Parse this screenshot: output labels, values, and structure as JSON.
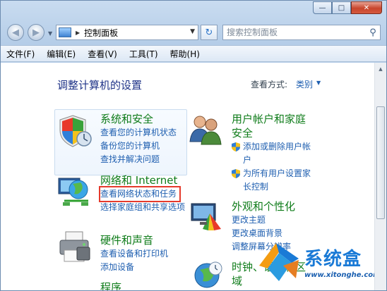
{
  "window": {
    "caption_minimize": "—",
    "caption_maximize": "□",
    "caption_close": "✕"
  },
  "address_bar": {
    "back_glyph": "◀",
    "forward_glyph": "▶",
    "path_label": "控制面板",
    "chevron": "▶",
    "dropdown": "▼",
    "refresh_glyph": "↻"
  },
  "search": {
    "placeholder": "搜索控制面板",
    "icon": "search-icon"
  },
  "menu": [
    "文件(F)",
    "编辑(E)",
    "查看(V)",
    "工具(T)",
    "帮助(H)"
  ],
  "content": {
    "title": "调整计算机的设置",
    "view_label": "查看方式:",
    "view_value": "类别",
    "view_drop": "▼"
  },
  "categories": {
    "system_security": {
      "title": "系统和安全",
      "links": [
        "查看您的计算机状态",
        "备份您的计算机",
        "查找并解决问题"
      ]
    },
    "network": {
      "title": "网络和 Internet",
      "links": [
        "查看网络状态和任务",
        "选择家庭组和共享选项"
      ]
    },
    "hardware": {
      "title": "硬件和声音",
      "links": [
        "查看设备和打印机",
        "添加设备"
      ]
    },
    "program_partial": "程序",
    "user_accounts": {
      "title_line1": "用户帐户和家庭",
      "title_line2": "安全",
      "links": [
        {
          "line1": "添加或删除用户帐",
          "line2": "户"
        },
        {
          "line1": "为所有用户设置家",
          "line2": "长控制"
        }
      ]
    },
    "appearance": {
      "title": "外观和个性化",
      "links": [
        "更改主题",
        "更改桌面背景",
        "调整屏幕分辨率"
      ]
    },
    "clock": {
      "title_line1": "时钟、语言和区",
      "title_line2": "域"
    }
  },
  "watermark": {
    "brand": "系统盒",
    "url": "www.xitonghe.com"
  },
  "colors": {
    "category_title": "#0f7c1a",
    "link": "#1f5fb0",
    "highlight": "#e53a2c"
  }
}
